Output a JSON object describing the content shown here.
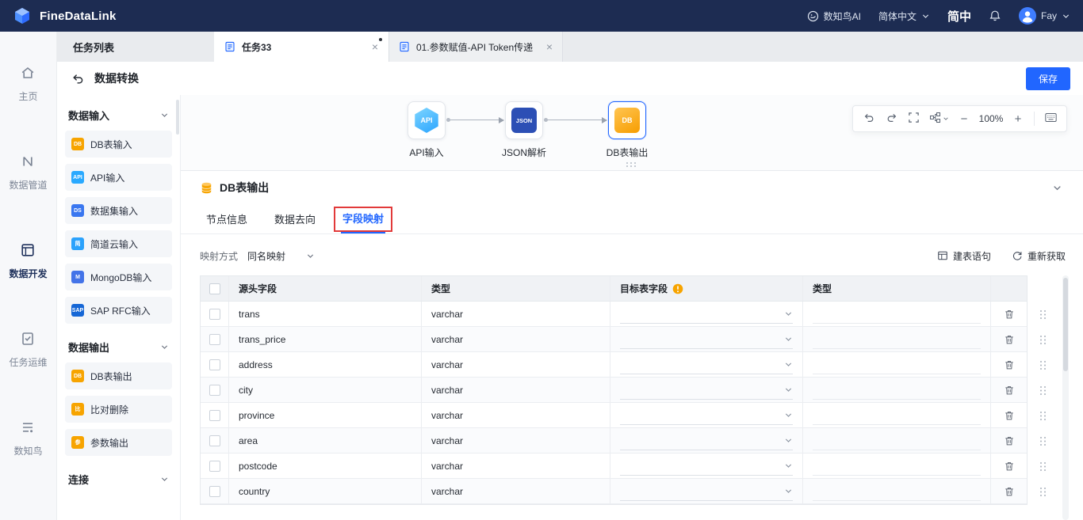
{
  "topbar": {
    "brand": "FineDataLink",
    "ai_label": "数知鸟AI",
    "language": "简体中文",
    "locale_short": "简中",
    "user": "Fay"
  },
  "app_sidebar": {
    "active_index": 2,
    "items": [
      {
        "id": "home",
        "label": "主页",
        "icon": "home"
      },
      {
        "id": "pipeline",
        "label": "数据管道",
        "icon": "pipeline"
      },
      {
        "id": "dev",
        "label": "数据开发",
        "icon": "dev"
      },
      {
        "id": "ops",
        "label": "任务运维",
        "icon": "ops"
      },
      {
        "id": "bird",
        "label": "数知鸟",
        "icon": "bird"
      }
    ]
  },
  "tabbar": {
    "task_list": "任务列表",
    "tabs": [
      {
        "label": "任务33",
        "active": true,
        "dirty": true
      },
      {
        "label": "01.参数赋值-API Token传递",
        "active": false,
        "dirty": false
      }
    ]
  },
  "subheader": {
    "title": "数据转换",
    "save": "保存"
  },
  "palette": {
    "sections": [
      {
        "title": "数据输入",
        "items": [
          {
            "label": "DB表输入",
            "glyph": "DB",
            "color": "#f7a400"
          },
          {
            "label": "API输入",
            "glyph": "API",
            "color": "#29a9ff"
          },
          {
            "label": "数据集输入",
            "glyph": "DS",
            "color": "#3a77f0"
          },
          {
            "label": "简道云输入",
            "glyph": "简",
            "color": "#2ba2fc"
          },
          {
            "label": "MongoDB输入",
            "glyph": "M",
            "color": "#4373e8"
          },
          {
            "label": "SAP RFC输入",
            "glyph": "SAP",
            "color": "#1667d6"
          }
        ]
      },
      {
        "title": "数据输出",
        "items": [
          {
            "label": "DB表输出",
            "glyph": "DB",
            "color": "#f7a400"
          },
          {
            "label": "比对删除",
            "glyph": "比",
            "color": "#f7a400"
          },
          {
            "label": "参数输出",
            "glyph": "参",
            "color": "#f7a400"
          }
        ]
      },
      {
        "title": "连接",
        "items": []
      }
    ]
  },
  "canvas": {
    "zoom": "100%",
    "nodes": [
      {
        "label": "API输入",
        "kind": "api",
        "selected": false
      },
      {
        "label": "JSON解析",
        "kind": "json",
        "selected": false
      },
      {
        "label": "DB表输出",
        "kind": "db",
        "selected": true
      }
    ]
  },
  "panel": {
    "title": "DB表输出",
    "tabs": [
      {
        "label": "节点信息",
        "active": false,
        "highlight": false
      },
      {
        "label": "数据去向",
        "active": false,
        "highlight": false
      },
      {
        "label": "字段映射",
        "active": true,
        "highlight": true
      }
    ],
    "mapping_label": "映射方式",
    "mapping_value": "同名映射",
    "action_create_table": "建表语句",
    "action_refetch": "重新获取",
    "table": {
      "headers": {
        "source": "源头字段",
        "type": "类型",
        "target": "目标表字段",
        "target_type": "类型"
      },
      "rows": [
        {
          "source": "trans",
          "type": "varchar"
        },
        {
          "source": "trans_price",
          "type": "varchar"
        },
        {
          "source": "address",
          "type": "varchar"
        },
        {
          "source": "city",
          "type": "varchar"
        },
        {
          "source": "province",
          "type": "varchar"
        },
        {
          "source": "area",
          "type": "varchar"
        },
        {
          "source": "postcode",
          "type": "varchar"
        },
        {
          "source": "country",
          "type": "varchar"
        }
      ]
    }
  },
  "colors": {
    "accent": "#2166ff",
    "topbar_bg": "#1d2c52",
    "warning": "#f7a400",
    "highlight_red": "#e23a3a",
    "node_api": "#2aa4ff",
    "node_json": "#2c4fb5",
    "node_db": "#f79d00"
  }
}
